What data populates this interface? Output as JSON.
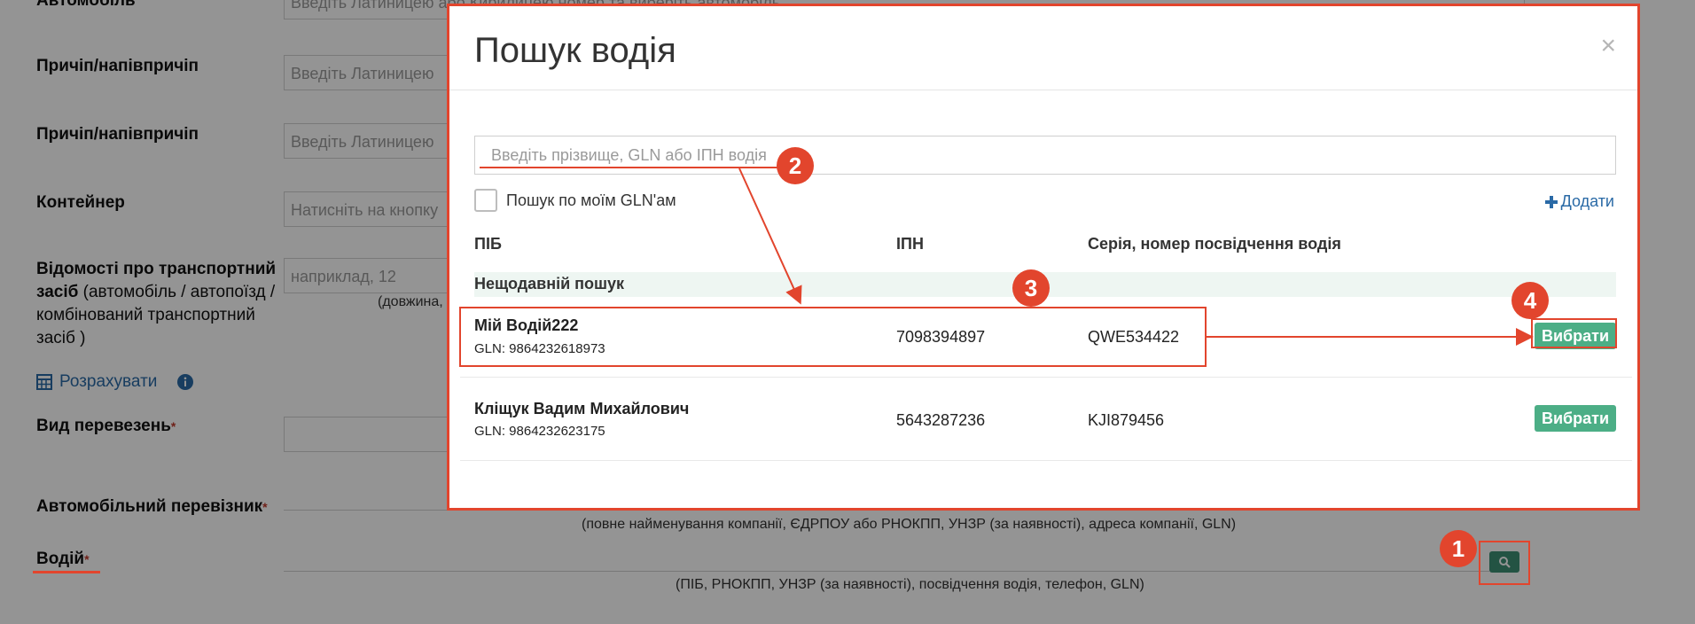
{
  "form": {
    "auto_label": "Автомобіль",
    "auto_placeholder": "Введіть Латиницею або Кирилицею номер та виберіть автомобіль",
    "trailer1_label": "Причіп/напівпричіп",
    "trailer1_placeholder": "Введіть Латиницею",
    "trailer2_label": "Причіп/напівпричіп",
    "trailer2_placeholder": "Введіть Латиницею",
    "container_label": "Контейнер",
    "container_placeholder": "Натисніть на кнопку",
    "vehicle_info_label": "Відомості про транспортний засіб",
    "vehicle_info_sub": "(автомобіль / автопоїзд / комбінований транспортний засіб )",
    "vehicle_info_placeholder": "наприклад, 12",
    "vehicle_info_hint": "(довжина,",
    "calc_link": "Розрахувати",
    "transport_type_label": "Вид перевезень",
    "carrier_label": "Автомобільний перевізник",
    "carrier_hint": "(повне найменування компанії, ЄДРПОУ або РНОКПП, УНЗР (за наявності), адреса компанії, GLN)",
    "driver_label": "Водій",
    "driver_hint": "(ПІБ, РНОКПП, УНЗР (за наявності), посвідчення водія, телефон, GLN)",
    "required_mark": "*"
  },
  "modal": {
    "title": "Пошук водія",
    "close": "×",
    "search_placeholder": "Введіть прізвище, GLN або ІПН водія",
    "checkbox_label": "Пошук по моїм GLN'ам",
    "add_label": "Додати",
    "columns": [
      "ПІБ",
      "ІПН",
      "Серія, номер посвідчення водія"
    ],
    "recent_label": "Нещодавній пошук",
    "rows": [
      {
        "name": "Мій Водій222",
        "gln": "GLN: 9864232618973",
        "ipn": "7098394897",
        "license": "QWE534422",
        "action": "Вибрати"
      },
      {
        "name": "Кліщук Вадим Михайлович",
        "gln": "GLN: 9864232623175",
        "ipn": "5643287236",
        "license": "KJI879456",
        "action": "Вибрати"
      }
    ]
  },
  "annotations": {
    "steps": [
      "1",
      "2",
      "3",
      "4"
    ],
    "color": "#e2452d"
  },
  "colors": {
    "accent_green": "#4cae86",
    "link_blue": "#2a6aa6",
    "annotation_red": "#e2452d"
  }
}
